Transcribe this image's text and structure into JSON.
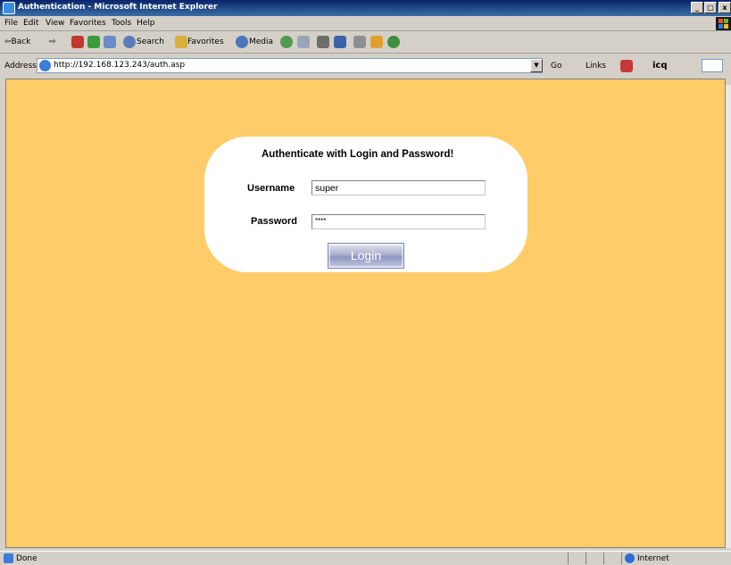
{
  "window": {
    "title": "Authentication - Microsoft Internet Explorer",
    "min_glyph": "_",
    "max_glyph": "□",
    "close_glyph": "x"
  },
  "menu": [
    "File",
    "Edit",
    "View",
    "Favorites",
    "Tools",
    "Help"
  ],
  "toolbar": {
    "back": "⇦Back",
    "forward": "⇨",
    "search": "Search",
    "favorites": "Favorites",
    "media": "Media"
  },
  "address": {
    "label": "Address",
    "url": "http://192.168.123.243/auth.asp",
    "go": "Go",
    "links": "Links",
    "icq": "icq"
  },
  "login": {
    "title": "Authenticate with Login and Password!",
    "username_label": "Username",
    "username_value": "super",
    "password_label": "Password",
    "password_value": "****",
    "button": "Login"
  },
  "status": {
    "text": "Done",
    "zone": "Internet"
  },
  "colors": {
    "page_bg": "#fecc69",
    "panel_bg": "#ffffff"
  },
  "icons": [
    "ie-icon",
    "back-icon",
    "forward-icon",
    "stop-icon",
    "refresh-icon",
    "home-icon",
    "search-icon",
    "favorites-icon",
    "media-icon",
    "history-icon",
    "mail-icon",
    "print-icon",
    "edit-icon",
    "discuss-icon",
    "messenger-icon",
    "go-icon",
    "globe-icon"
  ]
}
